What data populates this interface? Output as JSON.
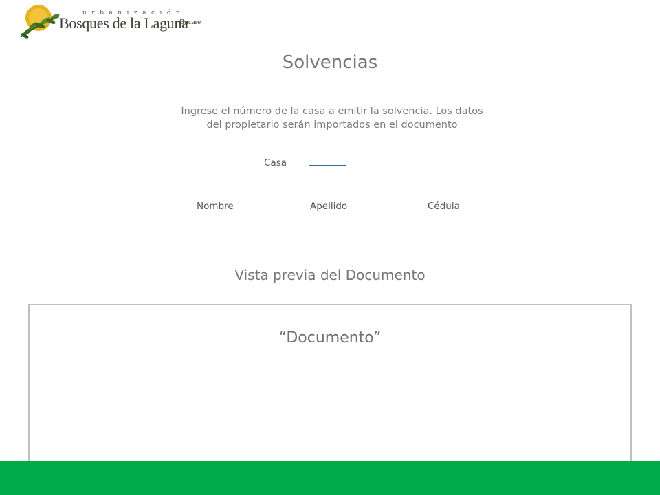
{
  "logo": {
    "small_text": "urbanización",
    "main_text": "Bosques de la Laguna",
    "sub_text": "Bucare"
  },
  "page": {
    "title": "Solvencias",
    "instructions": "Ingrese el número de la casa a emitir la solvencia. Los datos del propietario serán importados en el documento"
  },
  "form": {
    "casa_label": "Casa",
    "casa_value": "",
    "owner_fields": {
      "nombre": "Nombre",
      "apellido": "Apellido",
      "cedula": "Cédula"
    }
  },
  "preview": {
    "title": "Vista previa del Documento",
    "document_title": "“Documento”"
  },
  "colors": {
    "accent_green": "#00ab4a",
    "header_line": "#3aa146",
    "input_underline": "#2e6da4"
  },
  "icons": [
    "logo-sun-leaves-icon"
  ]
}
